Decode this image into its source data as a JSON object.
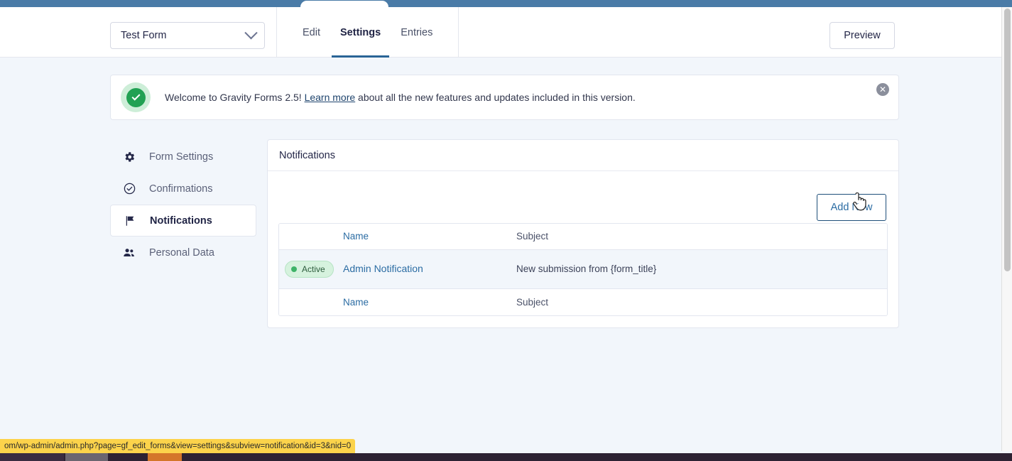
{
  "browser": {
    "tab_strip_color": "#4a7ba7"
  },
  "topbar": {
    "form_selector": {
      "value": "Test Form",
      "icon": "chevron-down-icon"
    },
    "tabs": [
      {
        "label": "Edit",
        "active": false
      },
      {
        "label": "Settings",
        "active": true
      },
      {
        "label": "Entries",
        "active": false
      }
    ],
    "preview_label": "Preview"
  },
  "banner": {
    "icon": "check-circle-icon",
    "text_before": "Welcome to Gravity Forms 2.5! ",
    "link_text": "Learn more",
    "text_after": " about all the new features and updates included in this version.",
    "close_icon": "close-circle-icon",
    "accent_color": "#21a153"
  },
  "sidebar": {
    "items": [
      {
        "label": "Form Settings",
        "icon": "gear-icon",
        "active": false
      },
      {
        "label": "Confirmations",
        "icon": "check-circle-icon",
        "active": false
      },
      {
        "label": "Notifications",
        "icon": "flag-icon",
        "active": true
      },
      {
        "label": "Personal Data",
        "icon": "users-icon",
        "active": false
      }
    ]
  },
  "panel": {
    "title": "Notifications",
    "add_new_label": "Add New",
    "table": {
      "columns": [
        "",
        "Name",
        "Subject"
      ],
      "header": {
        "name": "Name",
        "subject": "Subject"
      },
      "footer": {
        "name": "Name",
        "subject": "Subject"
      },
      "rows": [
        {
          "status_label": "Active",
          "status_color": "#3eb368",
          "name": "Admin Notification",
          "subject": "New submission from {form_title}"
        }
      ]
    }
  },
  "statusbar": {
    "url": "om/wp-admin/admin.php?page=gf_edit_forms&view=settings&subview=notification&id=3&nid=0"
  }
}
